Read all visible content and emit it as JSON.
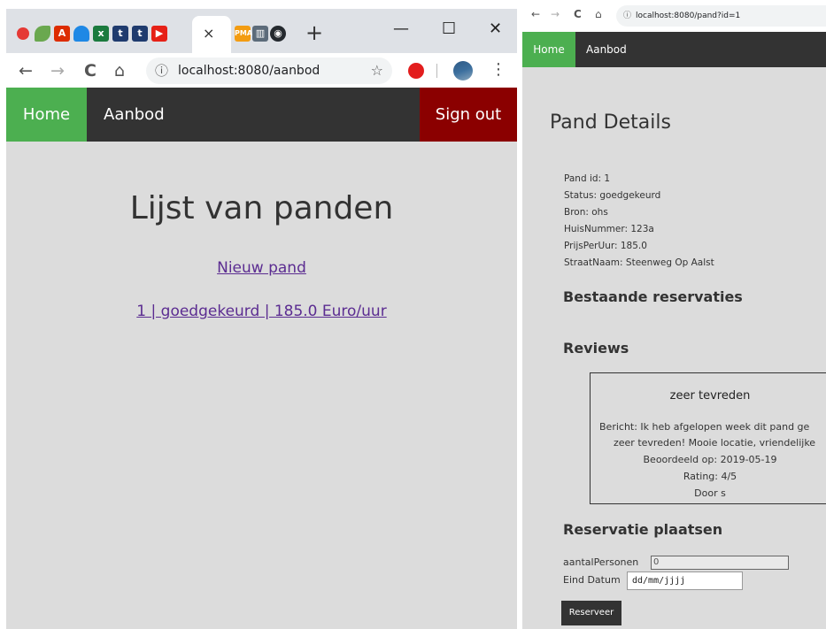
{
  "left": {
    "browser": {
      "tab_close": "×",
      "new_tab": "+",
      "minimize": "—",
      "maximize": "☐",
      "close": "✕",
      "back": "←",
      "forward": "→",
      "reload": "C",
      "home": "⌂",
      "url": "localhost:8080/aanbod",
      "bookmark": "☆",
      "menu": "⋮"
    },
    "nav": {
      "home": "Home",
      "aanbod": "Aanbod",
      "signout": "Sign out"
    },
    "page": {
      "title": "Lijst van panden",
      "new_link": "Nieuw pand",
      "item_link": "1 | goedgekeurd | 185.0 Euro/uur"
    }
  },
  "right": {
    "browser": {
      "back": "←",
      "forward": "→",
      "reload": "C",
      "home": "⌂",
      "url": "localhost:8080/pand?id=1"
    },
    "nav": {
      "home": "Home",
      "aanbod": "Aanbod"
    },
    "page": {
      "title": "Pand Details",
      "details": [
        "Pand id: 1",
        "Status: goedgekeurd",
        "Bron: ohs",
        "HuisNummer: 123a",
        "PrijsPerUur: 185.0",
        "StraatNaam: Steenweg Op Aalst"
      ],
      "reservations_heading": "Bestaande reservaties",
      "reviews_heading": "Reviews",
      "review": {
        "title": "zeer tevreden",
        "message_line1": "Bericht: Ik heb afgelopen week dit pand ge",
        "message_line2": "zeer tevreden! Mooie locatie, vriendelijke",
        "date": "Beoordeeld op: 2019-05-19",
        "rating": "Rating: 4/5",
        "author": "Door s"
      },
      "form": {
        "heading": "Reservatie plaatsen",
        "persons_label": "aantalPersonen",
        "persons_value": "0",
        "date_label": "Eind Datum",
        "date_placeholder": "dd/mm/jjjj",
        "submit": "Reserveer"
      }
    }
  }
}
